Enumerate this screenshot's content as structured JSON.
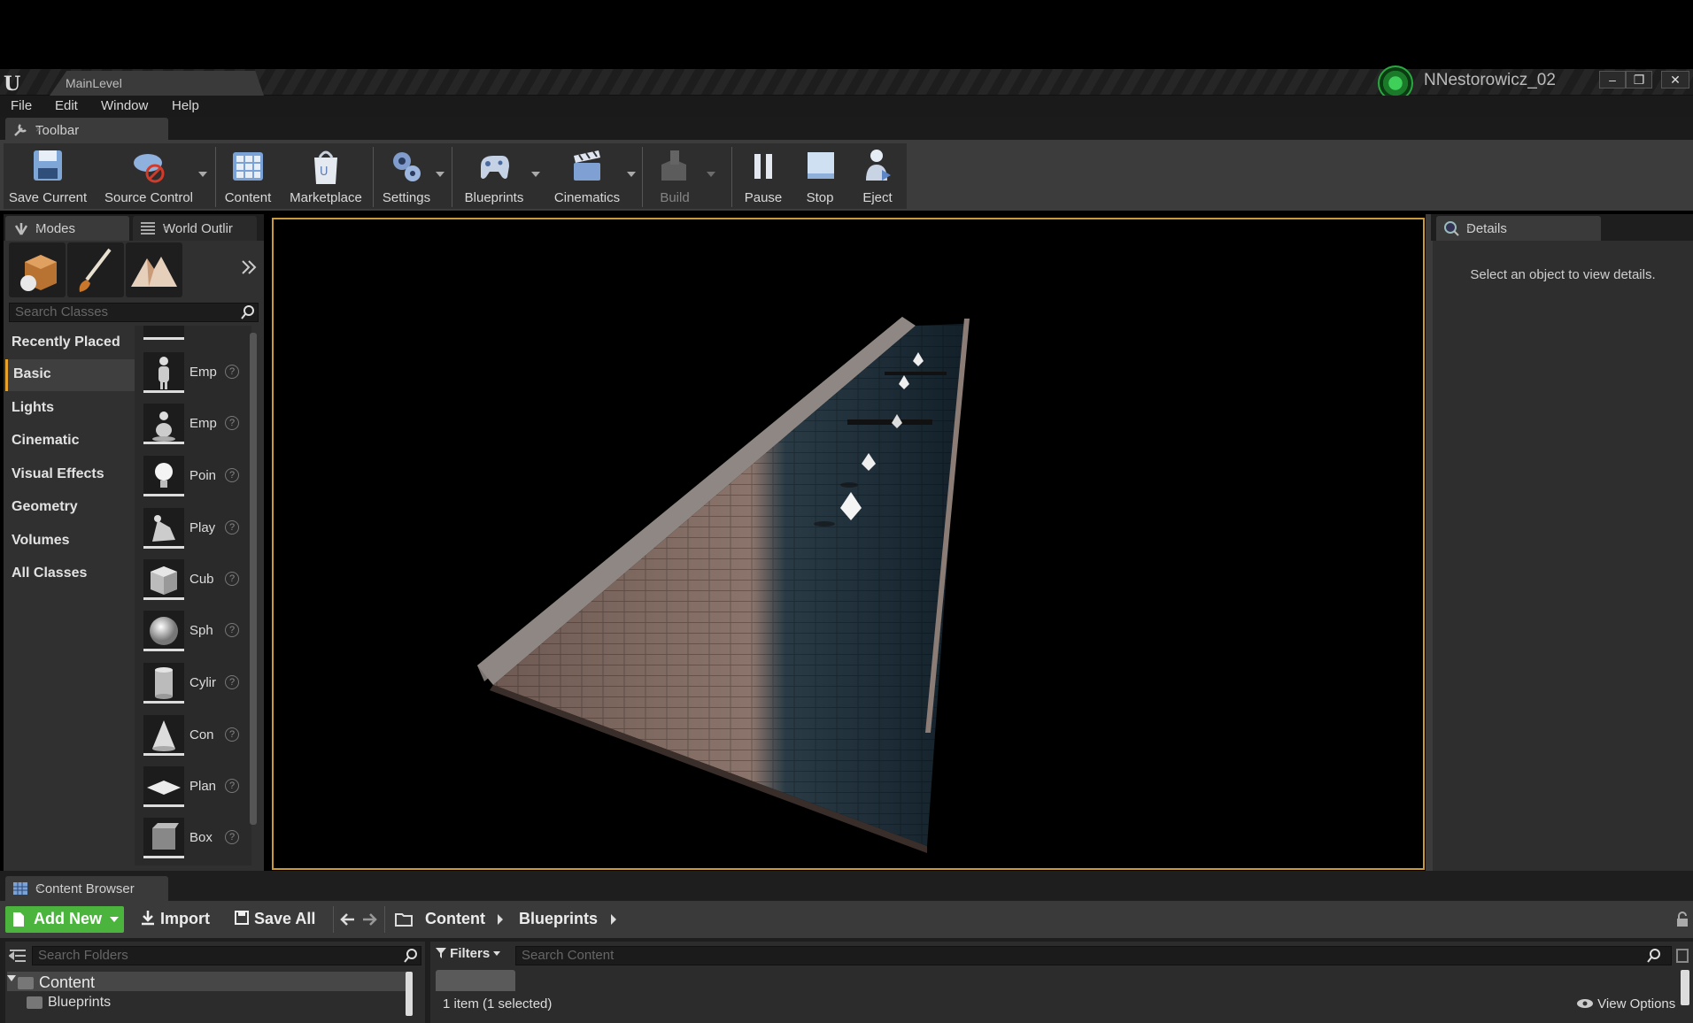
{
  "titlebar": {
    "level_tab": "MainLevel",
    "user_name": "NNestorowicz_02",
    "min": "–",
    "restore": "❐",
    "close": "✕"
  },
  "menu": [
    "File",
    "Edit",
    "Window",
    "Help"
  ],
  "toolbar": {
    "tab_label": "Toolbar",
    "buttons": [
      {
        "label": "Save Current",
        "icon": "save-icon"
      },
      {
        "label": "Source Control",
        "icon": "source-control-icon"
      },
      {
        "label": "Content",
        "icon": "content-icon"
      },
      {
        "label": "Marketplace",
        "icon": "marketplace-icon"
      },
      {
        "label": "Settings",
        "icon": "settings-icon"
      },
      {
        "label": "Blueprints",
        "icon": "blueprints-icon"
      },
      {
        "label": "Cinematics",
        "icon": "cinematics-icon"
      },
      {
        "label": "Build",
        "icon": "build-icon"
      },
      {
        "label": "Pause",
        "icon": "pause-icon"
      },
      {
        "label": "Stop",
        "icon": "stop-icon"
      },
      {
        "label": "Eject",
        "icon": "eject-icon"
      }
    ]
  },
  "left_panel": {
    "tabs": [
      "Modes",
      "World Outlir"
    ],
    "search_placeholder": "Search Classes",
    "categories": [
      "Recently Placed",
      "Basic",
      "Lights",
      "Cinematic",
      "Visual Effects",
      "Geometry",
      "Volumes",
      "All Classes"
    ],
    "active_category": "Basic",
    "items": [
      "Emp",
      "Emp",
      "Poin",
      "Play",
      "Cub",
      "Sph",
      "Cylir",
      "Con",
      "Plan",
      "Box"
    ]
  },
  "details": {
    "tab_label": "Details",
    "message": "Select an object to view details."
  },
  "content_browser": {
    "tab_label": "Content Browser",
    "add_new": "Add New",
    "import": "Import",
    "save_all": "Save All",
    "breadcrumb": [
      "Content",
      "Blueprints"
    ],
    "search_folders_placeholder": "Search Folders",
    "filters": "Filters",
    "search_content_placeholder": "Search Content",
    "tree": [
      "Content",
      "Blueprints"
    ],
    "status": "1 item (1 selected)",
    "view_options": "View Options"
  },
  "colors": {
    "accent_orange": "#e8a22a",
    "add_new_green": "#4bb43d",
    "viewport_border": "#c99a3a"
  }
}
